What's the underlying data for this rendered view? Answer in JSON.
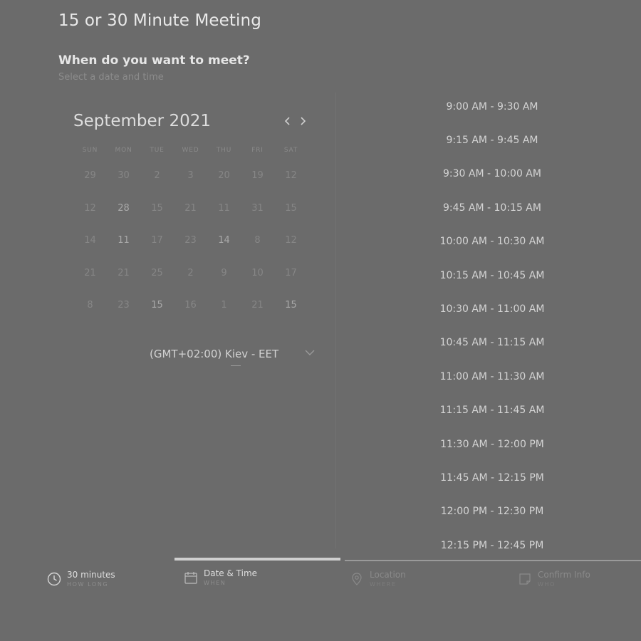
{
  "header": {
    "title": "15 or 30 Minute Meeting",
    "question": "When do you want to meet?",
    "subtitle": "Select a date and time"
  },
  "calendar": {
    "month_label": "September 2021",
    "weekdays": [
      "SUN",
      "MON",
      "TUE",
      "WED",
      "THU",
      "FRI",
      "SAT"
    ],
    "weeks": [
      [
        "29",
        "30",
        "2",
        "3",
        "20",
        "19",
        "12"
      ],
      [
        "12",
        "28",
        "15",
        "21",
        "11",
        "31",
        "15"
      ],
      [
        "14",
        "11",
        "17",
        "23",
        "14",
        "8",
        "12"
      ],
      [
        "21",
        "21",
        "25",
        "2",
        "9",
        "10",
        "17"
      ],
      [
        "8",
        "23",
        "15",
        "16",
        "1",
        "21",
        "15"
      ]
    ],
    "timezone": "(GMT+02:00) Kiev - EET"
  },
  "time_slots": [
    "9:00 AM - 9:30 AM",
    "9:15 AM - 9:45 AM",
    "9:30 AM - 10:00 AM",
    "9:45 AM - 10:15 AM",
    "10:00 AM - 10:30 AM",
    "10:15 AM - 10:45 AM",
    "10:30 AM - 11:00 AM",
    "10:45 AM - 11:15 AM",
    "11:00 AM - 11:30 AM",
    "11:15 AM - 11:45 AM",
    "11:30 AM - 12:00 PM",
    "11:45 AM - 12:15 PM",
    "12:00 PM - 12:30 PM",
    "12:15 PM - 12:45 PM"
  ],
  "steps": [
    {
      "title": "30 minutes",
      "sub": "HOW LONG",
      "icon": "clock-icon"
    },
    {
      "title": "Date & Time",
      "sub": "WHEN",
      "icon": "calendar-icon"
    },
    {
      "title": "Location",
      "sub": "WHERE",
      "icon": "location-pin-icon"
    },
    {
      "title": "Confirm Info",
      "sub": "WHO",
      "icon": "document-icon"
    }
  ],
  "active_step": 1
}
